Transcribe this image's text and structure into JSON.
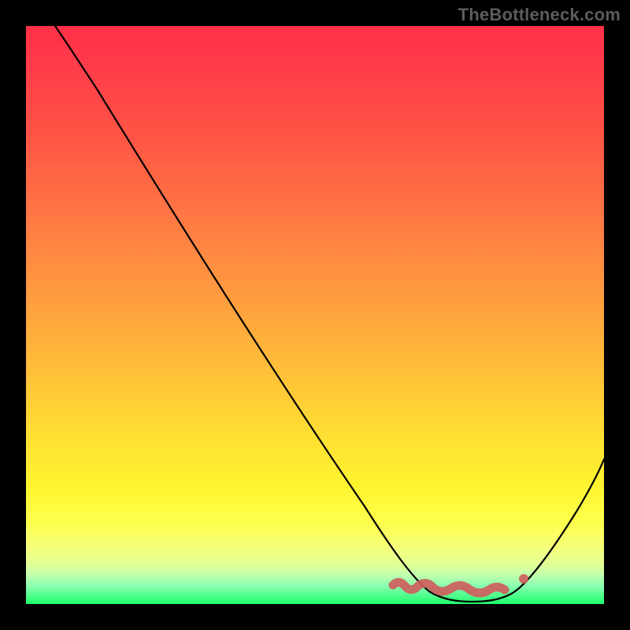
{
  "watermark": "TheBottleneck.com",
  "colors": {
    "background": "#000000",
    "watermark_text": "#5c5c5c",
    "curve": "#000000",
    "marker": "#cf5e5e",
    "gradient_stops": [
      "#ff2f47",
      "#ff3a4a",
      "#ff5245",
      "#ff7544",
      "#ff9a3f",
      "#ffc038",
      "#ffe232",
      "#fff52f",
      "#fdff4e",
      "#f6ff78",
      "#e4ff95",
      "#c1ffad",
      "#86ffb0",
      "#1cff6a"
    ]
  },
  "chart_data": {
    "type": "line",
    "title": "",
    "xlabel": "",
    "ylabel": "",
    "xlim": [
      0,
      100
    ],
    "ylim": [
      0,
      100
    ],
    "series": [
      {
        "name": "bottleneck-curve",
        "x": [
          5,
          8,
          12,
          16,
          22,
          28,
          34,
          40,
          46,
          52,
          58,
          63,
          66,
          70,
          74,
          78,
          82,
          86,
          90,
          94,
          100
        ],
        "y": [
          100,
          97,
          92,
          87,
          79,
          71,
          62,
          54,
          45,
          37,
          28,
          19,
          12,
          6,
          2,
          0,
          1,
          4,
          10,
          18,
          30
        ]
      }
    ],
    "annotation": {
      "name": "optimal-region-marker",
      "x_range": [
        63,
        84
      ],
      "y_approx": 2,
      "dot_x": 86,
      "dot_y": 4
    }
  }
}
